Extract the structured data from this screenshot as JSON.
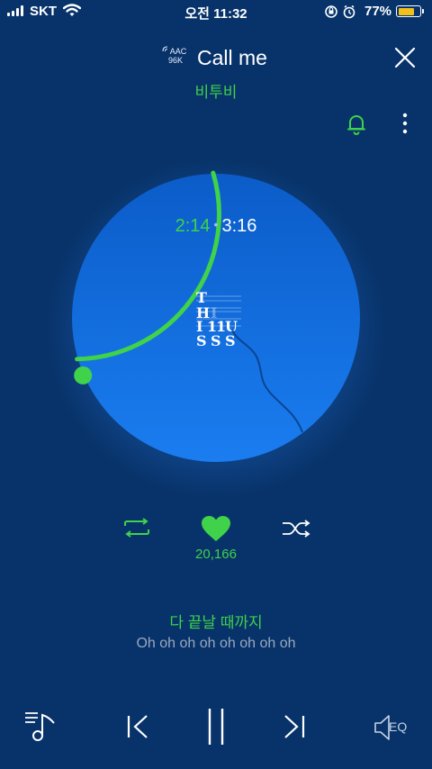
{
  "status_bar": {
    "carrier": "SKT",
    "time": "오전 11:32",
    "battery_pct": "77%",
    "battery_level": 0.77,
    "icons": [
      "signal-icon",
      "wifi-icon",
      "orientation-lock-icon",
      "alarm-icon",
      "battery-icon"
    ]
  },
  "header": {
    "codec_line1": "AAC",
    "codec_line2": "96K",
    "title": "Call me",
    "artist": "비투비"
  },
  "player": {
    "current_time": "2:14",
    "dot": "•",
    "total_time": "3:16",
    "progress": 0.685,
    "album_art_text": "THIS IS US",
    "like_count": "20,166"
  },
  "lyrics": {
    "current": "다 끝날 때까지",
    "next": "Oh oh oh oh oh oh oh oh"
  },
  "controls": {
    "eq_label": "EQ"
  },
  "colors": {
    "background": "#08336a",
    "accent": "#3fd24a",
    "disc": "#1a7df0"
  }
}
